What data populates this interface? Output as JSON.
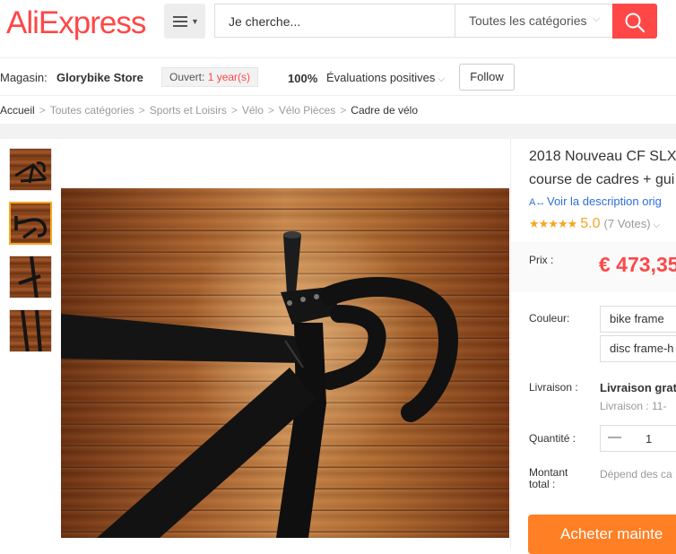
{
  "header": {
    "logo": "AliExpress",
    "logo_tm": "™",
    "search_placeholder": "Je cherche...",
    "category_select": "Toutes les catégories"
  },
  "store_bar": {
    "label": "Magasin:",
    "name": "Glorybike Store",
    "open_label": "Ouvert:",
    "open_value": "1 year(s)",
    "feedback_pct": "100%",
    "feedback_label": "Évaluations positives",
    "follow_label": "Follow"
  },
  "breadcrumb": [
    "Accueil",
    "Toutes catégories",
    "Sports et Loisirs",
    "Vélo",
    "Vélo Pièces",
    "Cadre de vélo"
  ],
  "product": {
    "title_line1": "2018 Nouveau CF SLX",
    "title_line2": "course de cadres + gui",
    "translate_label": "Voir la description orig",
    "rating_score": "5.0",
    "votes": "(7 Votes)",
    "price_label": "Prix :",
    "price": "€ 473,35",
    "color_label": "Couleur:",
    "color_options": [
      "bike frame",
      "disc frame-h"
    ],
    "shipping_label": "Livraison :",
    "shipping_value": "Livraison grat",
    "shipping_sub": "Livraison : 11-",
    "quantity_label": "Quantité :",
    "quantity_value": "1",
    "total_label_1": "Montant",
    "total_label_2": "total :",
    "total_value": "Dépend des ca",
    "buy_label": "Acheter mainte"
  },
  "colors": {
    "brand": "#ff4747",
    "price": "#ff4747",
    "star": "#f5a623",
    "buy_button": "#ff7f24",
    "link": "#2d6fd8"
  }
}
